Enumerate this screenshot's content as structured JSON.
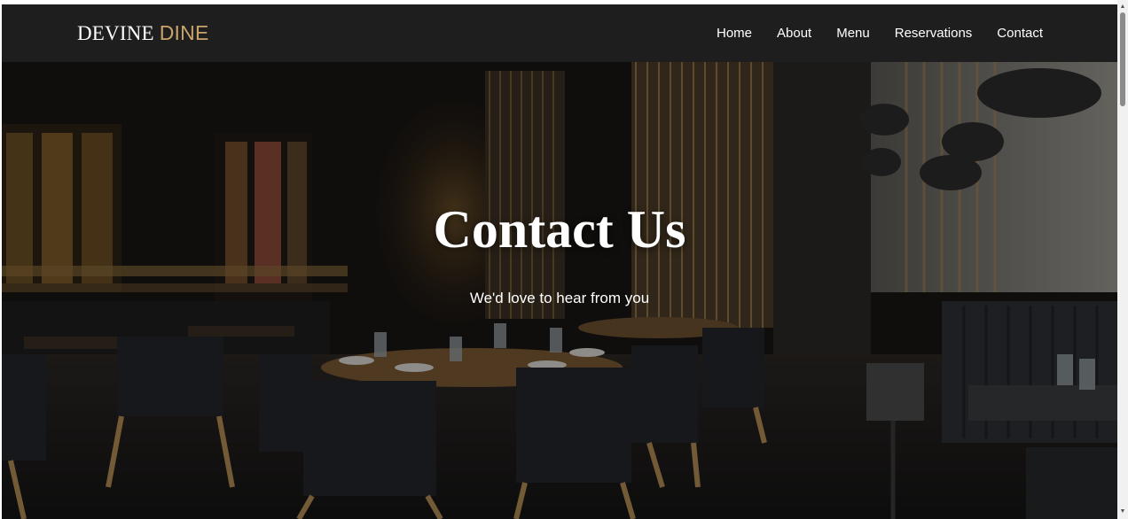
{
  "brand": {
    "name_main": "DEVINE",
    "name_accent": "DINE",
    "accent_color": "#c9a46a"
  },
  "nav": {
    "items": [
      {
        "label": "Home"
      },
      {
        "label": "About"
      },
      {
        "label": "Menu"
      },
      {
        "label": "Reservations"
      },
      {
        "label": "Contact"
      }
    ]
  },
  "hero": {
    "title": "Contact Us",
    "subtitle": "We'd love to hear from you",
    "background": "restaurant-interior-photo"
  },
  "scrollbar": {
    "up_icon": "triangle-up-icon",
    "down_icon": "triangle-down-icon"
  }
}
